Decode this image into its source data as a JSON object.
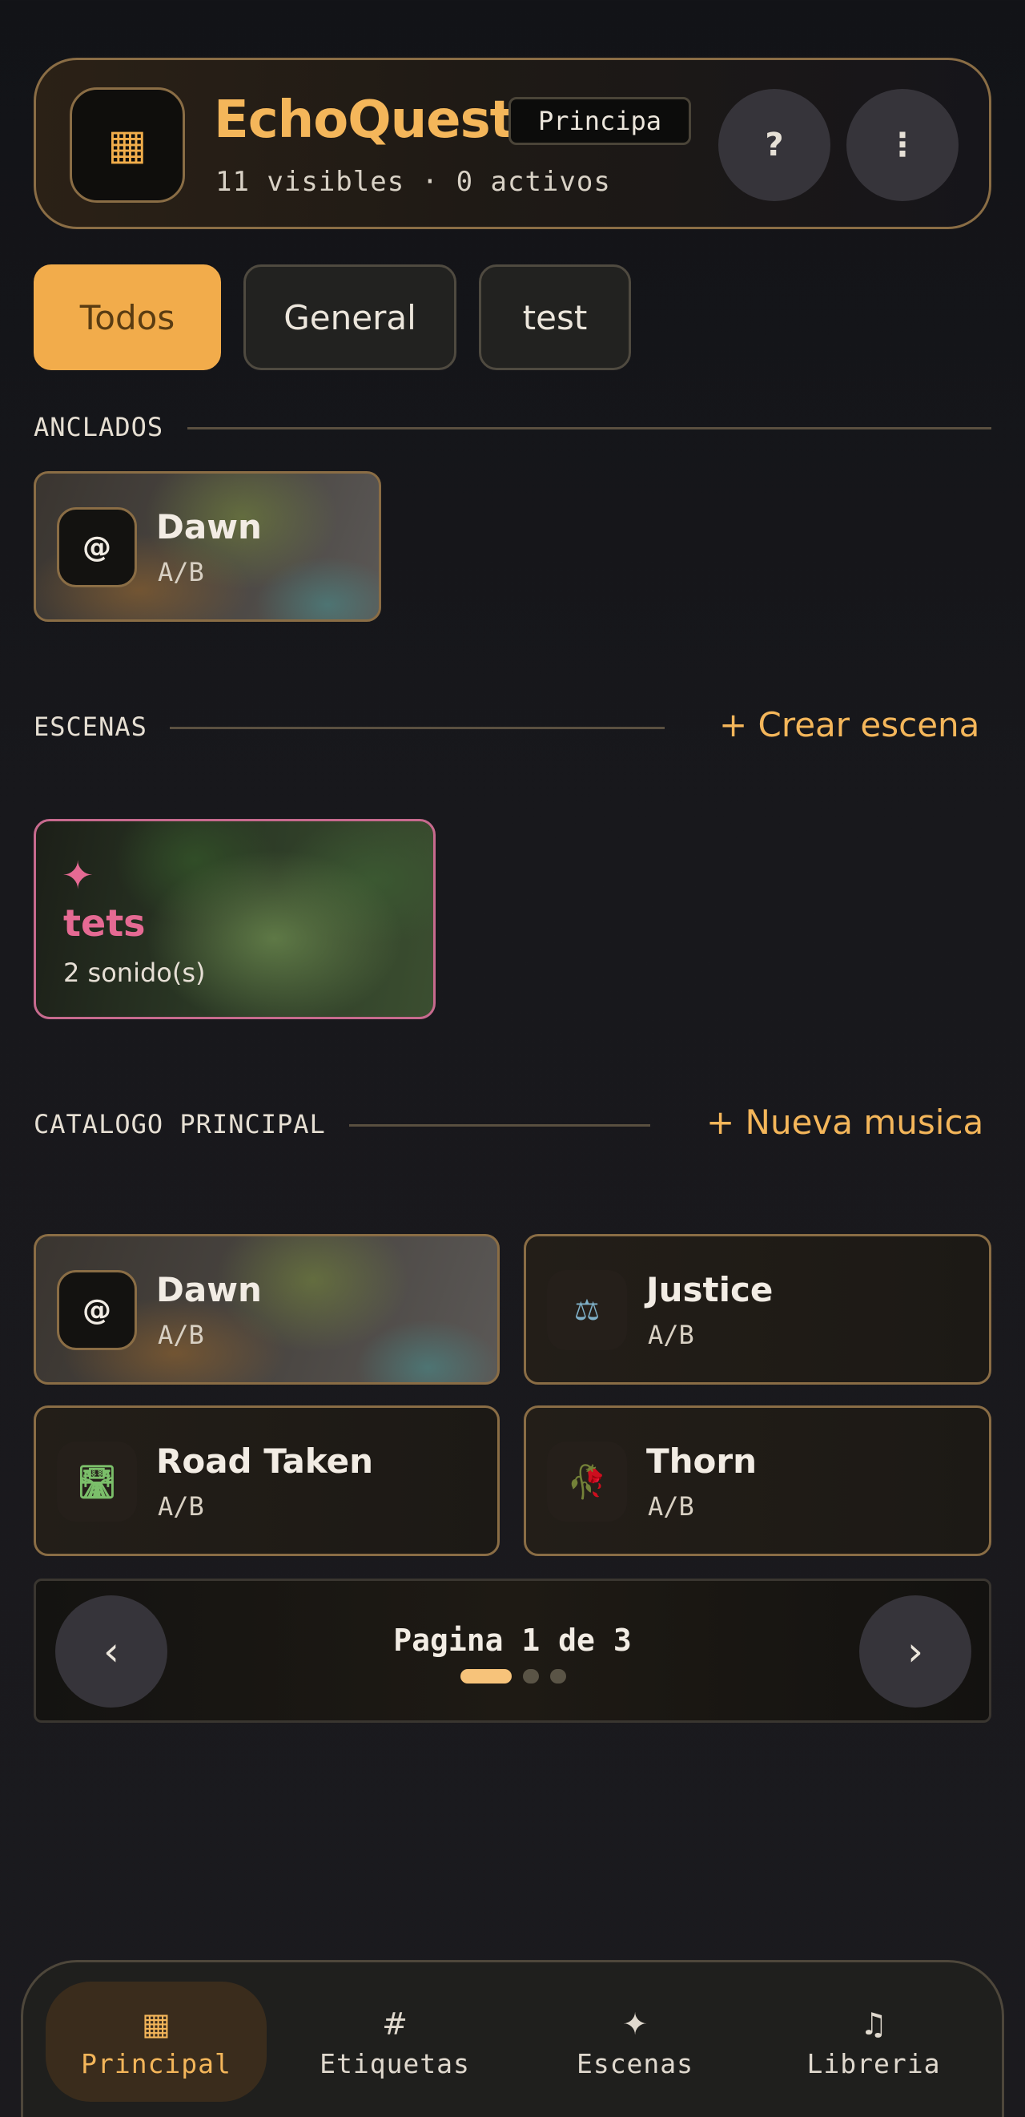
{
  "header": {
    "logo_icon": "▦",
    "title": "EchoQuest",
    "mode_badge": "Principa",
    "subtitle": "11 visibles · 0 activos",
    "help_label": "?",
    "menu_label": "⋮"
  },
  "filters": [
    {
      "label": "Todos",
      "active": true
    },
    {
      "label": "General",
      "active": false
    },
    {
      "label": "test",
      "active": false
    }
  ],
  "pinned": {
    "section_label": "ANCLADOS",
    "items": [
      {
        "title": "Dawn",
        "subtitle": "A/B",
        "icon": "@"
      }
    ]
  },
  "scenes": {
    "section_label": "ESCENAS",
    "action_label": "+ Crear escena",
    "items": [
      {
        "icon": "✦",
        "title": "tets",
        "subtitle": "2 sonido(s)"
      }
    ]
  },
  "catalog": {
    "section_label": "CATALOGO PRINCIPAL",
    "action_label": "+ Nueva musica",
    "items": [
      {
        "title": "Dawn",
        "subtitle": "A/B",
        "icon": "@"
      },
      {
        "title": "Justice",
        "subtitle": "A/B",
        "icon": "⚖"
      },
      {
        "title": "Road Taken",
        "subtitle": "A/B",
        "icon": "🛣"
      },
      {
        "title": "Thorn",
        "subtitle": "A/B",
        "icon": "🥀"
      }
    ]
  },
  "pagination": {
    "prev_label": "‹",
    "next_label": "›",
    "text": "Pagina 1 de 3",
    "current_page": 1,
    "total_pages": 3
  },
  "bottom_nav": [
    {
      "icon": "▦",
      "label": "Principal",
      "active": true
    },
    {
      "icon": "#",
      "label": "Etiquetas",
      "active": false
    },
    {
      "icon": "✦",
      "label": "Escenas",
      "active": false
    },
    {
      "icon": "♫",
      "label": "Libreria",
      "active": false
    }
  ],
  "colors": {
    "accent": "#f4b65a",
    "scene_accent": "#e56a93",
    "card_border": "#8a6d45",
    "background": "#16161a"
  }
}
